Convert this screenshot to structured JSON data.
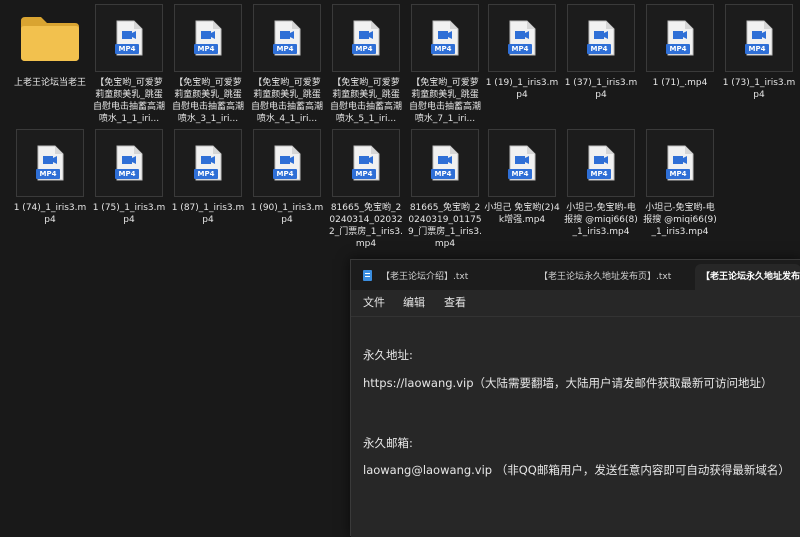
{
  "explorer": {
    "row1": [
      {
        "label": "上老王论坛当老王",
        "type": "folder"
      },
      {
        "label": "【免宝哟_可爱萝莉童颜美乳_跳蛋自慰电击抽蓄高潮喷水_1_1_iri...",
        "type": "mp4"
      },
      {
        "label": "【免宝哟_可爱萝莉童颜美乳_跳蛋自慰电击抽蓄高潮喷水_3_1_iri...",
        "type": "mp4"
      },
      {
        "label": "【免宝哟_可爱萝莉童颜美乳_跳蛋自慰电击抽蓄高潮喷水_4_1_iri...",
        "type": "mp4"
      },
      {
        "label": "【免宝哟_可爱萝莉童颜美乳_跳蛋自慰电击抽蓄高潮喷水_5_1_iri...",
        "type": "mp4"
      },
      {
        "label": "【免宝哟_可爱萝莉童颜美乳_跳蛋自慰电击抽蓄高潮喷水_7_1_iri...",
        "type": "mp4"
      },
      {
        "label": "1 (19)_1_iris3.mp4",
        "type": "mp4"
      },
      {
        "label": "1 (37)_1_iris3.mp4",
        "type": "mp4"
      },
      {
        "label": "1 (71)_.mp4",
        "type": "mp4"
      },
      {
        "label": "1 (73)_1_iris3.mp4",
        "type": "mp4"
      }
    ],
    "row2": [
      {
        "label": "1 (74)_1_iris3.mp4",
        "type": "mp4"
      },
      {
        "label": "1 (75)_1_iris3.mp4",
        "type": "mp4"
      },
      {
        "label": "1 (87)_1_iris3.mp4",
        "type": "mp4"
      },
      {
        "label": "1 (90)_1_iris3.mp4",
        "type": "mp4"
      },
      {
        "label": "81665_免宝哟_20240314_020322_门票房_1_iris3.mp4",
        "type": "mp4"
      },
      {
        "label": "81665_免宝哟_20240319_011759_门票房_1_iris3.mp4",
        "type": "mp4"
      },
      {
        "label": "小坦己 免宝哟(2)4k增强.mp4",
        "type": "mp4"
      },
      {
        "label": "小坦己-免宝哟-电报搜 @miqi66(8)_1_iris3.mp4",
        "type": "mp4"
      },
      {
        "label": "小坦己-免宝哟-电报搜 @miqi66(9)_1_iris3.mp4",
        "type": "mp4"
      }
    ],
    "file_badge": "MP4"
  },
  "notepad": {
    "tabs": [
      "【老王论坛介绍】.txt",
      "【老王论坛永久地址发布页】.txt",
      "【老王论坛永久地址发布页"
    ],
    "menu": [
      "文件",
      "编辑",
      "查看"
    ],
    "lines": [
      "永久地址:",
      "https://laowang.vip（大陆需要翻墙，大陆用户请发邮件获取最新可访问地址）",
      "永久邮箱:",
      "laowang@laowang.vip （非QQ邮箱用户，发送任意内容即可自动获得最新域名）"
    ]
  },
  "colors": {
    "background": "#191919",
    "folder": "#f2c14e",
    "mp4_badge": "#2f6fd6",
    "editor_bg": "#272727"
  }
}
